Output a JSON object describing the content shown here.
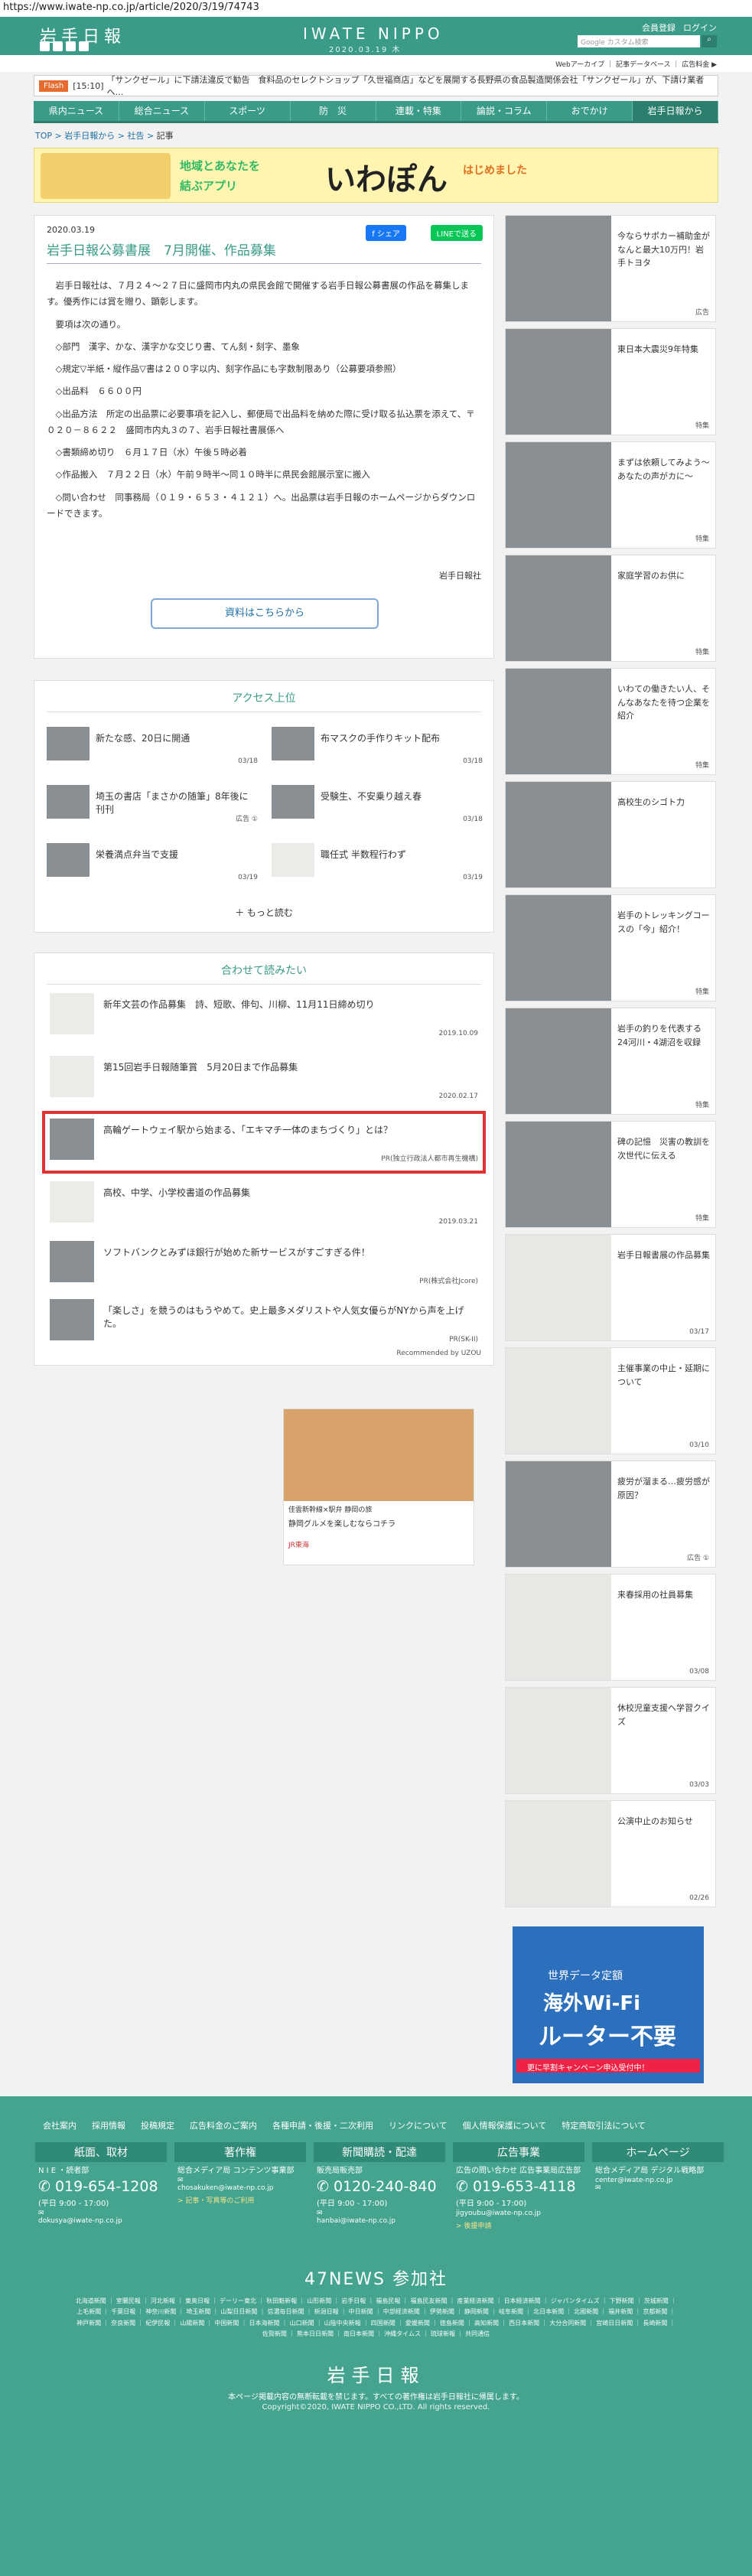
{
  "url": "https://www.iwate-np.co.jp/article/2020/3/19/74743",
  "header": {
    "logo": "岩手日報",
    "brand": "IWATE NIPPO",
    "date": "2020.03.19 木",
    "member_register": "会員登録",
    "login": "ログイン",
    "search_placeholder": "Google カスタム検索",
    "subnav": "Webアーカイブ ｜ 記事データベース ｜ 広告料金 ▶"
  },
  "ticker": {
    "tag": "Flash",
    "time": "[15:10]",
    "text": "「サンクゼール」に下請法違反で勧告　食料品のセレクトショップ「久世福商店」などを展開する長野県の食品製造関係会社「サンクゼール」が、下請け業者へ…"
  },
  "nav": [
    "県内ニュース",
    "総合ニュース",
    "スポーツ",
    "防　災",
    "連載・特集",
    "論説・コラム",
    "おでかけ",
    "岩手日報から"
  ],
  "breadcrumb": {
    "items": [
      "TOP",
      "岩手日報から",
      "社告"
    ],
    "current": "記事"
  },
  "banner": {
    "line1": "地域とあなたを",
    "line2": "結ぶアプリ",
    "app": "いわぽん",
    "tagline": "はじめました"
  },
  "article": {
    "date": "2020.03.19",
    "title": "岩手日報公募書展　7月開催、作品募集",
    "share_fb": "f シェア",
    "share_line": "LINEで送る",
    "paragraphs": [
      "岩手日報社は、７月２４～２７日に盛岡市内丸の県民会館で開催する岩手日報公募書展の作品を募集します。優秀作には賞を贈り、顕彰します。",
      "要項は次の通り。",
      "◇部門　漢字、かな、漢字かな交じり書、てん刻・刻字、墨象",
      "◇規定▽半紙・縦作品▽書は２００字以内、刻字作品にも字数制限あり（公募要項参照）",
      "◇出品料　６６００円",
      "◇出品方法　所定の出品票に必要事項を記入し、郵便局で出品料を納めた際に受け取る払込票を添えて、〒０２０－８６２２　盛岡市内丸３の７、岩手日報社書展係へ",
      "◇書類締め切り　６月１７日（水）午後５時必着",
      "◇作品搬入　７月２２日（水）午前９時半～同１０時半に県民会館展示室に搬入",
      "◇問い合わせ　同事務局（０１９・６５３・４１２１）へ。出品票は岩手日報のホームページからダウンロードできます。"
    ],
    "credit": "岩手日報社",
    "cta": "資料はこちらから"
  },
  "ranking": {
    "title": "アクセス上位",
    "items": [
      {
        "text": "新たな感、20日に開通",
        "date": "03/18"
      },
      {
        "text": "布マスクの手作りキット配布",
        "date": "03/18"
      },
      {
        "text": "埼玉の書店「まさかの随筆」8年後に刊刊",
        "date": "広告 ①"
      },
      {
        "text": "受験生、不安乗り越え春",
        "date": "03/18"
      },
      {
        "text": "栄養満点弁当で支援",
        "date": "03/19"
      },
      {
        "text": "職任式 半数程行わず",
        "date": "03/19"
      }
    ],
    "more": "もっと読む"
  },
  "related": {
    "title": "合わせて読みたい",
    "items": [
      {
        "text": "新年文芸の作品募集　詩、短歌、俳句、川柳、11月11日締め切り",
        "date": "2019.10.09",
        "blank": true
      },
      {
        "text": "第15回岩手日報随筆賞　5月20日まで作品募集",
        "date": "2020.02.17",
        "blank": true
      },
      {
        "text": "高輪ゲートウェイ駅から始まる、「エキマチ一体のまちづくり」とは？",
        "date": "PR(独立行政法人都市再生機構)",
        "blank": false
      },
      {
        "text": "高校、中学、小学校書道の作品募集",
        "date": "2019.03.21",
        "blank": true
      },
      {
        "text": "ソフトバンクとみずほ銀行が始めた新サービスがすごすぎる件！",
        "date": "PR(株式会社Jcore)",
        "blank": false
      },
      {
        "text": "「楽しさ」を競うのはもうやめて。史上最多メダリストや人気女優らがNYから声を上げた。",
        "date": "PR(SK-II)",
        "blank": false
      }
    ],
    "powered": "Recommended by UZOU"
  },
  "ad_left": {
    "line1": "佳雲新幹線×駅弁 静岡の旅",
    "line2": "静岡グルメを楽しむならコチラ",
    "line3": "JR東海"
  },
  "side": {
    "items": [
      {
        "text": "今ならサポカー補助金がなんと最大10万円！岩手トヨタ",
        "tag": "広告"
      },
      {
        "text": "東日本大震災9年特集",
        "tag": "特集"
      },
      {
        "text": "まずは依頼してみよう～あなたの声がカに～",
        "tag": "特集"
      },
      {
        "text": "家庭学習のお供に",
        "tag": "特集"
      },
      {
        "text": "いわての働きたい人、そんなあなたを待つ企業を紹介",
        "tag": "特集"
      },
      {
        "text": "高校生のシゴト力",
        "tag": ""
      },
      {
        "text": "岩手のトレッキングコースの「今」紹介！",
        "tag": "特集"
      },
      {
        "text": "岩手の釣りを代表する24河川・4湖沼を収録",
        "tag": "特集"
      },
      {
        "text": "碑の記憶　災害の教訓を次世代に伝える",
        "tag": "特集"
      },
      {
        "text": "岩手日報書展の作品募集",
        "tag": "03/17"
      },
      {
        "text": "主催事業の中止・延期について",
        "tag": "03/10"
      },
      {
        "text": "疲労が溜まる…疲労感が原因？",
        "tag": "広告 ①"
      },
      {
        "text": "来春採用の社員募集",
        "tag": "03/08"
      },
      {
        "text": "休校児童支援へ学習クイズ",
        "tag": "03/03"
      },
      {
        "text": "公演中止のお知らせ",
        "tag": "02/26"
      }
    ],
    "ad": {
      "a1": "世界データ定額",
      "a2": "海外Wi-Fi",
      "a3": "ルーター不要",
      "a4": "更に早割キャンペーン申込受付中！"
    }
  },
  "footer": {
    "links": [
      "会社案内",
      "採用情報",
      "投稿規定",
      "広告料金のご案内",
      "各種申請・後援・二次利用",
      "リンクについて",
      "個人情報保護について",
      "特定商取引法について"
    ],
    "cols": [
      {
        "head": "紙面、取材",
        "sub": "N I E ・読者部",
        "tel": "019-654-1208",
        "hours": "(平日 9:00 - 17:00)",
        "mail": "dokusya@iwate-np.co.jp",
        "link": ""
      },
      {
        "head": "著作権",
        "sub": "総合メディア局 コンテンツ事業部",
        "tel": "",
        "hours": "",
        "mail": "chosakuken@iwate-np.co.jp",
        "link": "> 記事・写真等のご利用"
      },
      {
        "head": "新聞購読・配達",
        "sub": "販売局販売部",
        "tel": "0120-240-840",
        "hours": "(平日 9:00 - 17:00)",
        "mail": "hanbai@iwate-np.co.jp",
        "link": ""
      },
      {
        "head": "広告事業",
        "sub": "広告の問い合わせ 広告事業局広告部",
        "tel": "019-653-4118",
        "hours": "(平日 9:00 - 17:00)",
        "mail": "jigyoubu@iwate-np.co.jp",
        "link": "> 後援申請"
      },
      {
        "head": "ホームページ",
        "sub": "総合メディア局 デジタル戦略部",
        "tel": "",
        "hours": "",
        "mail": "center@iwate-np.co.jp",
        "link": ""
      }
    ],
    "news47": "47NEWS 参加社",
    "news47_list": "北海道新聞 ｜ 室蘭民報 ｜ 河北新報 ｜ 東奥日報 ｜ デーリー東北 ｜ 秋田魁新報 ｜ 山形新聞 ｜ 岩手日報 ｜ 福島民報 ｜ 福島民友新聞 ｜ 産業経済新聞 ｜ 日本経済新聞 ｜ ジャパンタイムズ ｜ 下野新聞 ｜ 茨城新聞 ｜ 上毛新聞 ｜ 千葉日報 ｜ 神奈川新聞 ｜ 埼玉新聞 ｜ 山梨日日新聞 ｜ 信濃毎日新聞 ｜ 新潟日報 ｜ 中日新聞 ｜ 中部経済新聞 ｜ 伊勢新聞 ｜ 静岡新聞 ｜ 岐阜新聞 ｜ 北日本新聞 ｜ 北國新聞 ｜ 福井新聞 ｜ 京都新聞 ｜ 神戸新聞 ｜ 奈良新聞 ｜ 紀伊民報 ｜ 山陽新聞 ｜ 中国新聞 ｜ 日本海新聞 ｜ 山口新聞 ｜ 山陰中央新報 ｜ 四国新聞 ｜ 愛媛新聞 ｜ 徳島新聞 ｜ 高知新聞 ｜ 西日本新聞 ｜ 大分合同新聞 ｜ 宮崎日日新聞 ｜ 長崎新聞 ｜ 佐賀新聞 ｜ 熊本日日新聞 ｜ 南日本新聞 ｜ 沖縄タイムス ｜ 琉球新報 ｜ 共同通信",
    "logo": "岩手日報",
    "note": "本ページ掲載内容の無断転載を禁じます。すべての著作権は岩手日報社に帰属します。",
    "copyright": "Copyright©2020, IWATE NIPPO CO.,LTD. All rights reserved."
  }
}
